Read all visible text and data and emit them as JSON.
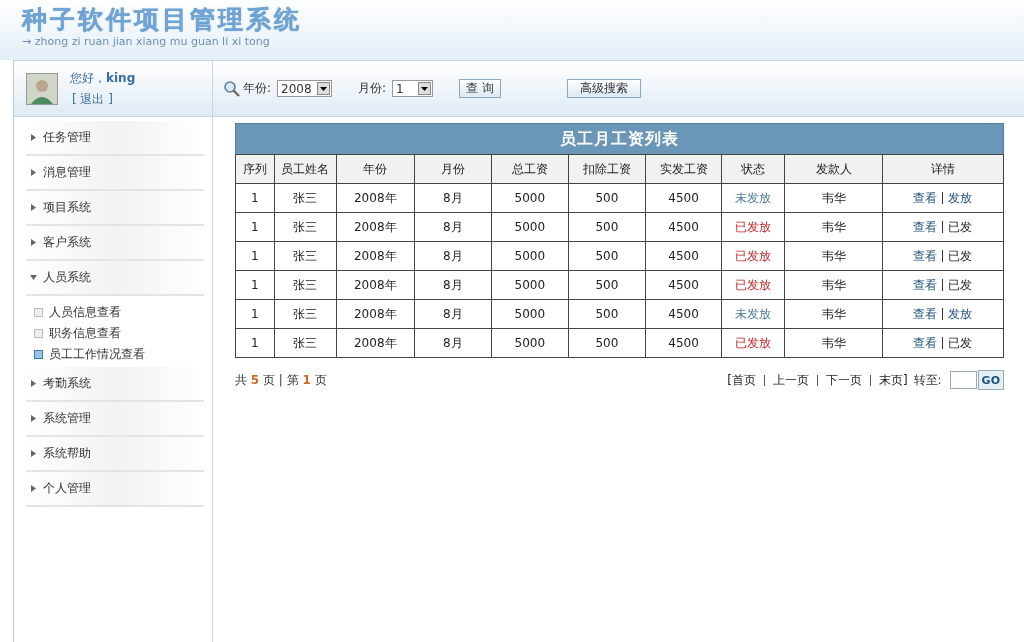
{
  "header": {
    "title": "种子软件项目管理系统",
    "subtitle": "→ zhong zi ruan jian xiang mu guan li xi tong"
  },
  "user": {
    "greeting": "您好，",
    "name": "king",
    "logout": "[ 退出 ]"
  },
  "sidebar": {
    "items": [
      {
        "label": "任务管理",
        "expanded": false
      },
      {
        "label": "消息管理",
        "expanded": false
      },
      {
        "label": "项目系统",
        "expanded": false
      },
      {
        "label": "客户系统",
        "expanded": false
      },
      {
        "label": "人员系统",
        "expanded": true,
        "children": [
          {
            "label": "人员信息查看",
            "selected": false
          },
          {
            "label": "职务信息查看",
            "selected": false
          },
          {
            "label": "员工工作情况查看",
            "selected": true
          }
        ]
      },
      {
        "label": "考勤系统",
        "expanded": false
      },
      {
        "label": "系统管理",
        "expanded": false
      },
      {
        "label": "系统帮助",
        "expanded": false
      },
      {
        "label": "个人管理",
        "expanded": false
      }
    ]
  },
  "search": {
    "year_label": "年份:",
    "year": "2008",
    "month_label": "月份:",
    "month": "1",
    "query_button": "查 询",
    "advanced_button": "高级搜索"
  },
  "table": {
    "title": "员工月工资列表",
    "columns": [
      "序列",
      "员工姓名",
      "年份",
      "月份",
      "总工资",
      "扣除工资",
      "实发工资",
      "状态",
      "发款人",
      "详情"
    ],
    "rows": [
      {
        "cells": [
          "1",
          "张三",
          "2008年",
          "8月",
          "5000",
          "500",
          "4500"
        ],
        "status": "未发放",
        "paid": false,
        "payer": "韦华",
        "view": "查看",
        "action": "发放"
      },
      {
        "cells": [
          "1",
          "张三",
          "2008年",
          "8月",
          "5000",
          "500",
          "4500"
        ],
        "status": "已发放",
        "paid": true,
        "payer": "韦华",
        "view": "查看",
        "action": "已发"
      },
      {
        "cells": [
          "1",
          "张三",
          "2008年",
          "8月",
          "5000",
          "500",
          "4500"
        ],
        "status": "已发放",
        "paid": true,
        "payer": "韦华",
        "view": "查看",
        "action": "已发"
      },
      {
        "cells": [
          "1",
          "张三",
          "2008年",
          "8月",
          "5000",
          "500",
          "4500"
        ],
        "status": "已发放",
        "paid": true,
        "payer": "韦华",
        "view": "查看",
        "action": "已发"
      },
      {
        "cells": [
          "1",
          "张三",
          "2008年",
          "8月",
          "5000",
          "500",
          "4500"
        ],
        "status": "未发放",
        "paid": false,
        "payer": "韦华",
        "view": "查看",
        "action": "发放"
      },
      {
        "cells": [
          "1",
          "张三",
          "2008年",
          "8月",
          "5000",
          "500",
          "4500"
        ],
        "status": "已发放",
        "paid": true,
        "payer": "韦华",
        "view": "查看",
        "action": "已发"
      }
    ]
  },
  "pager": {
    "summary": "共 **5** 页 | 第 **1** 页",
    "links": [
      "[首页",
      "上一页",
      "下一页",
      "末页]"
    ],
    "goto_label": "转至:",
    "go_button": "GO"
  }
}
